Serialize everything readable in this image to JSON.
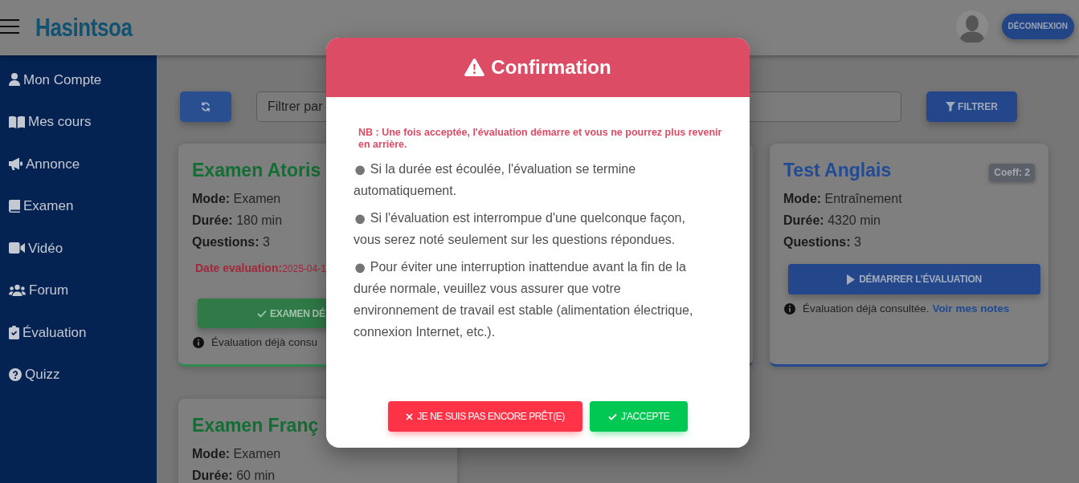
{
  "header": {
    "logo": "Hasintsoa",
    "logout_button": "DÉCONNEXION"
  },
  "sidebar": {
    "items": [
      {
        "label": "Mon Compte"
      },
      {
        "label": "Mes cours"
      },
      {
        "label": "Annonce"
      },
      {
        "label": "Examen"
      },
      {
        "label": "Vidéo"
      },
      {
        "label": "Forum"
      },
      {
        "label": "Évaluation"
      },
      {
        "label": "Quizz"
      }
    ]
  },
  "toolbar": {
    "filter_field": {
      "placeholder": "Filtrer par"
    },
    "filter_button": "FILTRER"
  },
  "cards": [
    {
      "kind": "exam",
      "title": "Examen Atoris",
      "details": [
        {
          "label": "Mode:",
          "value": "Examen"
        },
        {
          "label": "Durée:",
          "value": "180 min"
        },
        {
          "label": "Questions:",
          "value": "3"
        }
      ],
      "date": {
        "label": "Date evaluation:",
        "value": "2025-04-1"
      },
      "button": {
        "kind": "done",
        "label": "EXAMEN DÉ"
      },
      "info": {
        "text": "Évaluation déjà consu"
      }
    },
    {
      "kind": "practice"
    },
    {
      "kind": "practice",
      "title": "Test Anglais",
      "badge": "Coeff: 2",
      "details": [
        {
          "label": "Mode:",
          "value": "Entraînement"
        },
        {
          "label": "Durée:",
          "value": "4320 min"
        },
        {
          "label": "Questions:",
          "value": "3"
        }
      ],
      "button": {
        "kind": "start",
        "label": "DÉMARRER L’ÉVALUATION"
      },
      "info": {
        "text": "Évaluation déjà consultée.",
        "link": "Voir mes notes"
      }
    },
    {
      "kind": "exam",
      "title": "Examen Franç",
      "details": [
        {
          "label": "Mode:",
          "value": "Examen"
        },
        {
          "label": "Durée:",
          "value": "60 min"
        }
      ]
    }
  ],
  "modal": {
    "title": "Confirmation",
    "note": "NB : Une fois acceptée, l'évaluation démarre et vous ne pourrez plus revenir en arrière.",
    "points": [
      {
        "bullet": "●",
        "text": "Si la durée est écoulée, l'évaluation se termine automatiquement."
      },
      {
        "bullet": "●",
        "text": "Si l'évaluation est interrompue d'une quelconque façon, vous serez noté seulement sur les questions répondues."
      },
      {
        "bullet": "●",
        "text": "Pour éviter une interruption inattendue avant la fin de la durée normale, veuillez vous assurer que votre environnement de travail est stable (alimentation électrique, connexion Internet, etc.)."
      }
    ],
    "buttons": [
      {
        "kind": "cancel",
        "label": "JE NE SUIS PAS ENCORE PRÊT(E)"
      },
      {
        "kind": "accept",
        "label": "J'ACCEPTE"
      }
    ]
  }
}
